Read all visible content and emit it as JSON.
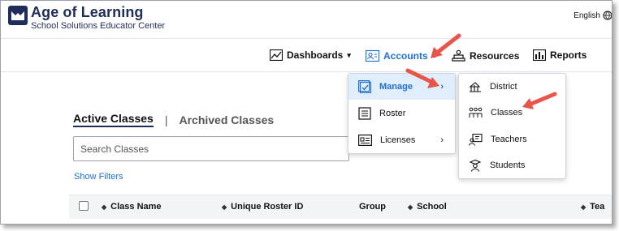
{
  "brand": {
    "name": "Age of Learning",
    "subtitle": "School Solutions Educator Center"
  },
  "header": {
    "language": "English"
  },
  "nav": {
    "items": [
      {
        "label": "Dashboards",
        "icon": "chart-icon"
      },
      {
        "label": "Accounts",
        "icon": "accounts-icon"
      },
      {
        "label": "Resources",
        "icon": "resources-icon"
      },
      {
        "label": "Reports",
        "icon": "reports-icon"
      }
    ]
  },
  "accounts_menu": {
    "items": [
      {
        "label": "Manage",
        "icon": "manage-icon"
      },
      {
        "label": "Roster",
        "icon": "roster-icon"
      },
      {
        "label": "Licenses",
        "icon": "licenses-icon"
      }
    ]
  },
  "manage_submenu": {
    "items": [
      {
        "label": "District",
        "icon": "district-icon"
      },
      {
        "label": "Classes",
        "icon": "classes-icon"
      },
      {
        "label": "Teachers",
        "icon": "teachers-icon"
      },
      {
        "label": "Students",
        "icon": "students-icon"
      }
    ]
  },
  "tabs": {
    "active": "Active Classes",
    "separator": "|",
    "inactive": "Archived Classes"
  },
  "search": {
    "placeholder": "Search Classes"
  },
  "filters": {
    "label": "Show Filters"
  },
  "table": {
    "columns": [
      "Class Name",
      "Unique Roster ID",
      "Group",
      "School",
      "Tea"
    ]
  },
  "colors": {
    "brand": "#1f2d5a",
    "link": "#1f6fd1",
    "highlight": "#e0edfb",
    "annotation_arrow": "#e8554a"
  }
}
